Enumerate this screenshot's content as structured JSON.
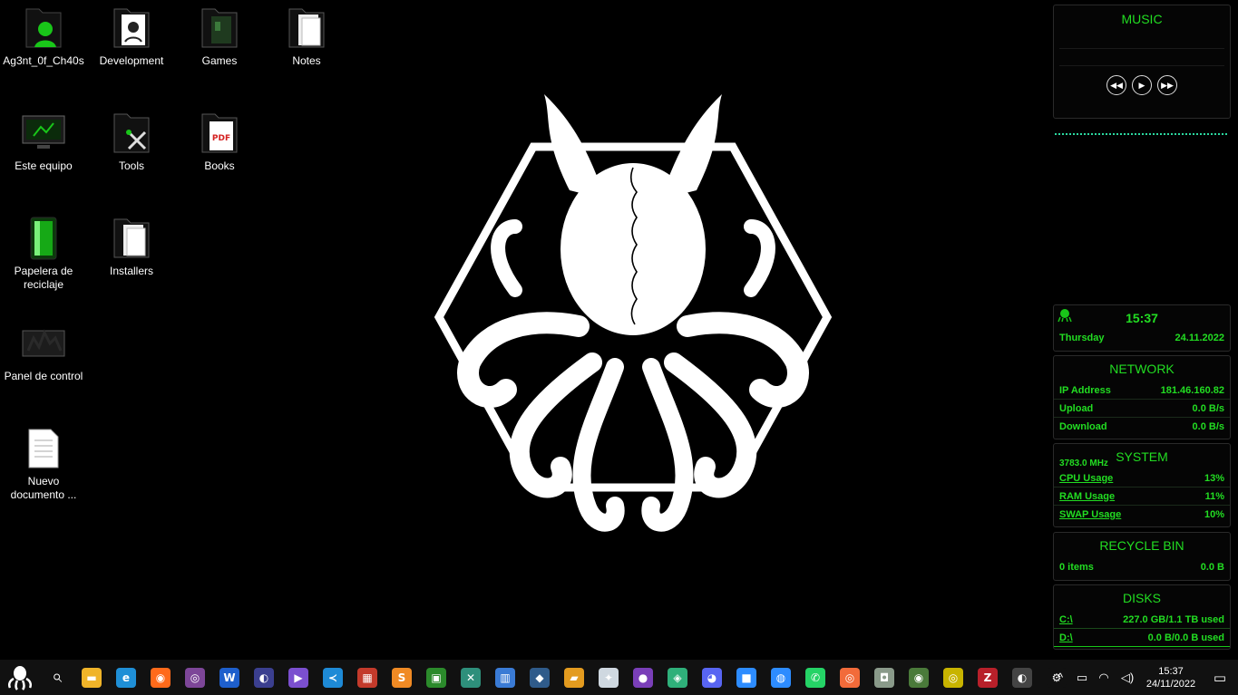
{
  "desktop": {
    "icons": [
      {
        "label": "Ag3nt_0f_Ch40s",
        "icon": "user-folder-icon"
      },
      {
        "label": "Development",
        "icon": "folder-icon"
      },
      {
        "label": "Games",
        "icon": "folder-icon"
      },
      {
        "label": "Notes",
        "icon": "folder-icon"
      },
      {
        "label": "Este equipo",
        "icon": "computer-icon"
      },
      {
        "label": "Tools",
        "icon": "tools-folder-icon"
      },
      {
        "label": "Books",
        "icon": "pdf-folder-icon"
      },
      {
        "label": "Papelera de\nreciclaje",
        "icon": "recycle-bin-icon"
      },
      {
        "label": "Installers",
        "icon": "folder-icon"
      },
      {
        "label": "Panel de control",
        "icon": "control-panel-icon"
      },
      {
        "label": "Nuevo\ndocumento ...",
        "icon": "text-document-icon"
      }
    ],
    "pdf_badge": "PDF"
  },
  "widgets": {
    "music": {
      "title": "MUSIC",
      "rewind": "◀◀",
      "play": "▶",
      "forward": "▶▶"
    },
    "clock": {
      "time": "15:37",
      "day": "Thursday",
      "date": "24.11.2022"
    },
    "network": {
      "title": "NETWORK",
      "rows": [
        {
          "key": "IP Address",
          "value": "181.46.160.82"
        },
        {
          "key": "Upload",
          "value": "0.0 B/s"
        },
        {
          "key": "Download",
          "value": "0.0 B/s"
        }
      ]
    },
    "system": {
      "title": "SYSTEM",
      "cpu_freq": "3783.0 MHz",
      "rows": [
        {
          "key": "CPU Usage",
          "value": "13%"
        },
        {
          "key": "RAM Usage",
          "value": "11%"
        },
        {
          "key": "SWAP Usage",
          "value": "10%"
        }
      ]
    },
    "recycle": {
      "title": "RECYCLE BIN",
      "items": "0 items",
      "size": "0.0 B"
    },
    "disks": {
      "title": "DISKS",
      "rows": [
        {
          "key": "C:\\",
          "value": "227.0 GB/1.1 TB used"
        },
        {
          "key": "D:\\",
          "value": "0.0 B/0.0 B used"
        }
      ]
    }
  },
  "taskbar": {
    "start_icon": "cthulhu-start-icon",
    "search_glyph": "⌕",
    "apps": [
      {
        "name": "file-explorer-icon",
        "glyph": "▬",
        "color": "#f0b429"
      },
      {
        "name": "edge-icon",
        "glyph": "e",
        "color": "#1f8fd6"
      },
      {
        "name": "firefox-icon",
        "glyph": "◉",
        "color": "#ff6a1a"
      },
      {
        "name": "tor-icon",
        "glyph": "◎",
        "color": "#7d4698"
      },
      {
        "name": "wps-icon",
        "glyph": "W",
        "color": "#1e5fcc"
      },
      {
        "name": "eclipse-icon",
        "glyph": "◐",
        "color": "#3b3f8f"
      },
      {
        "name": "visual-studio-icon",
        "glyph": "▶",
        "color": "#7b4fcf"
      },
      {
        "name": "vscode-icon",
        "glyph": "≺",
        "color": "#1e8ad6"
      },
      {
        "name": "winrar-icon",
        "glyph": "▦",
        "color": "#c33a2b"
      },
      {
        "name": "sublime-icon",
        "glyph": "S",
        "color": "#f08a24"
      },
      {
        "name": "terminal-icon",
        "glyph": "▣",
        "color": "#2b8a2b"
      },
      {
        "name": "maps-icon",
        "glyph": "✕",
        "color": "#2e8f7b"
      },
      {
        "name": "task-manager-icon",
        "glyph": "▥",
        "color": "#3a7bd5"
      },
      {
        "name": "mysql-workbench-icon",
        "glyph": "◆",
        "color": "#2f5b8a"
      },
      {
        "name": "sqlyog-icon",
        "glyph": "▰",
        "color": "#e39b1f"
      },
      {
        "name": "navicat-icon",
        "glyph": "✦",
        "color": "#cfd8e0"
      },
      {
        "name": "github-icon",
        "glyph": "●",
        "color": "#7a3fb8"
      },
      {
        "name": "gitkraken-icon",
        "glyph": "◈",
        "color": "#2fb07a"
      },
      {
        "name": "discord-icon",
        "glyph": "◕",
        "color": "#5865f2"
      },
      {
        "name": "zoom-icon",
        "glyph": "■",
        "color": "#2d8cff"
      },
      {
        "name": "messenger-icon",
        "glyph": "◍",
        "color": "#2d8cff"
      },
      {
        "name": "whatsapp-icon",
        "glyph": "✆",
        "color": "#25d366"
      },
      {
        "name": "postman-icon",
        "glyph": "◎",
        "color": "#f26b3a"
      },
      {
        "name": "vmware-icon",
        "glyph": "◘",
        "color": "#8a9a8a"
      },
      {
        "name": "globe-icon",
        "glyph": "◉",
        "color": "#4a7a3a"
      },
      {
        "name": "reader-icon",
        "glyph": "◎",
        "color": "#c8b400"
      },
      {
        "name": "filezilla-icon",
        "glyph": "Z",
        "color": "#b8202a"
      },
      {
        "name": "obs-icon",
        "glyph": "◐",
        "color": "#444444"
      },
      {
        "name": "settings-icon",
        "glyph": "⚙",
        "color": "#111111"
      }
    ],
    "tray": {
      "chevron": "^",
      "battery": "▭",
      "wifi": "◠",
      "volume": "◁)",
      "time": "15:37",
      "date": "24/11/2022",
      "notification": "▭"
    }
  }
}
